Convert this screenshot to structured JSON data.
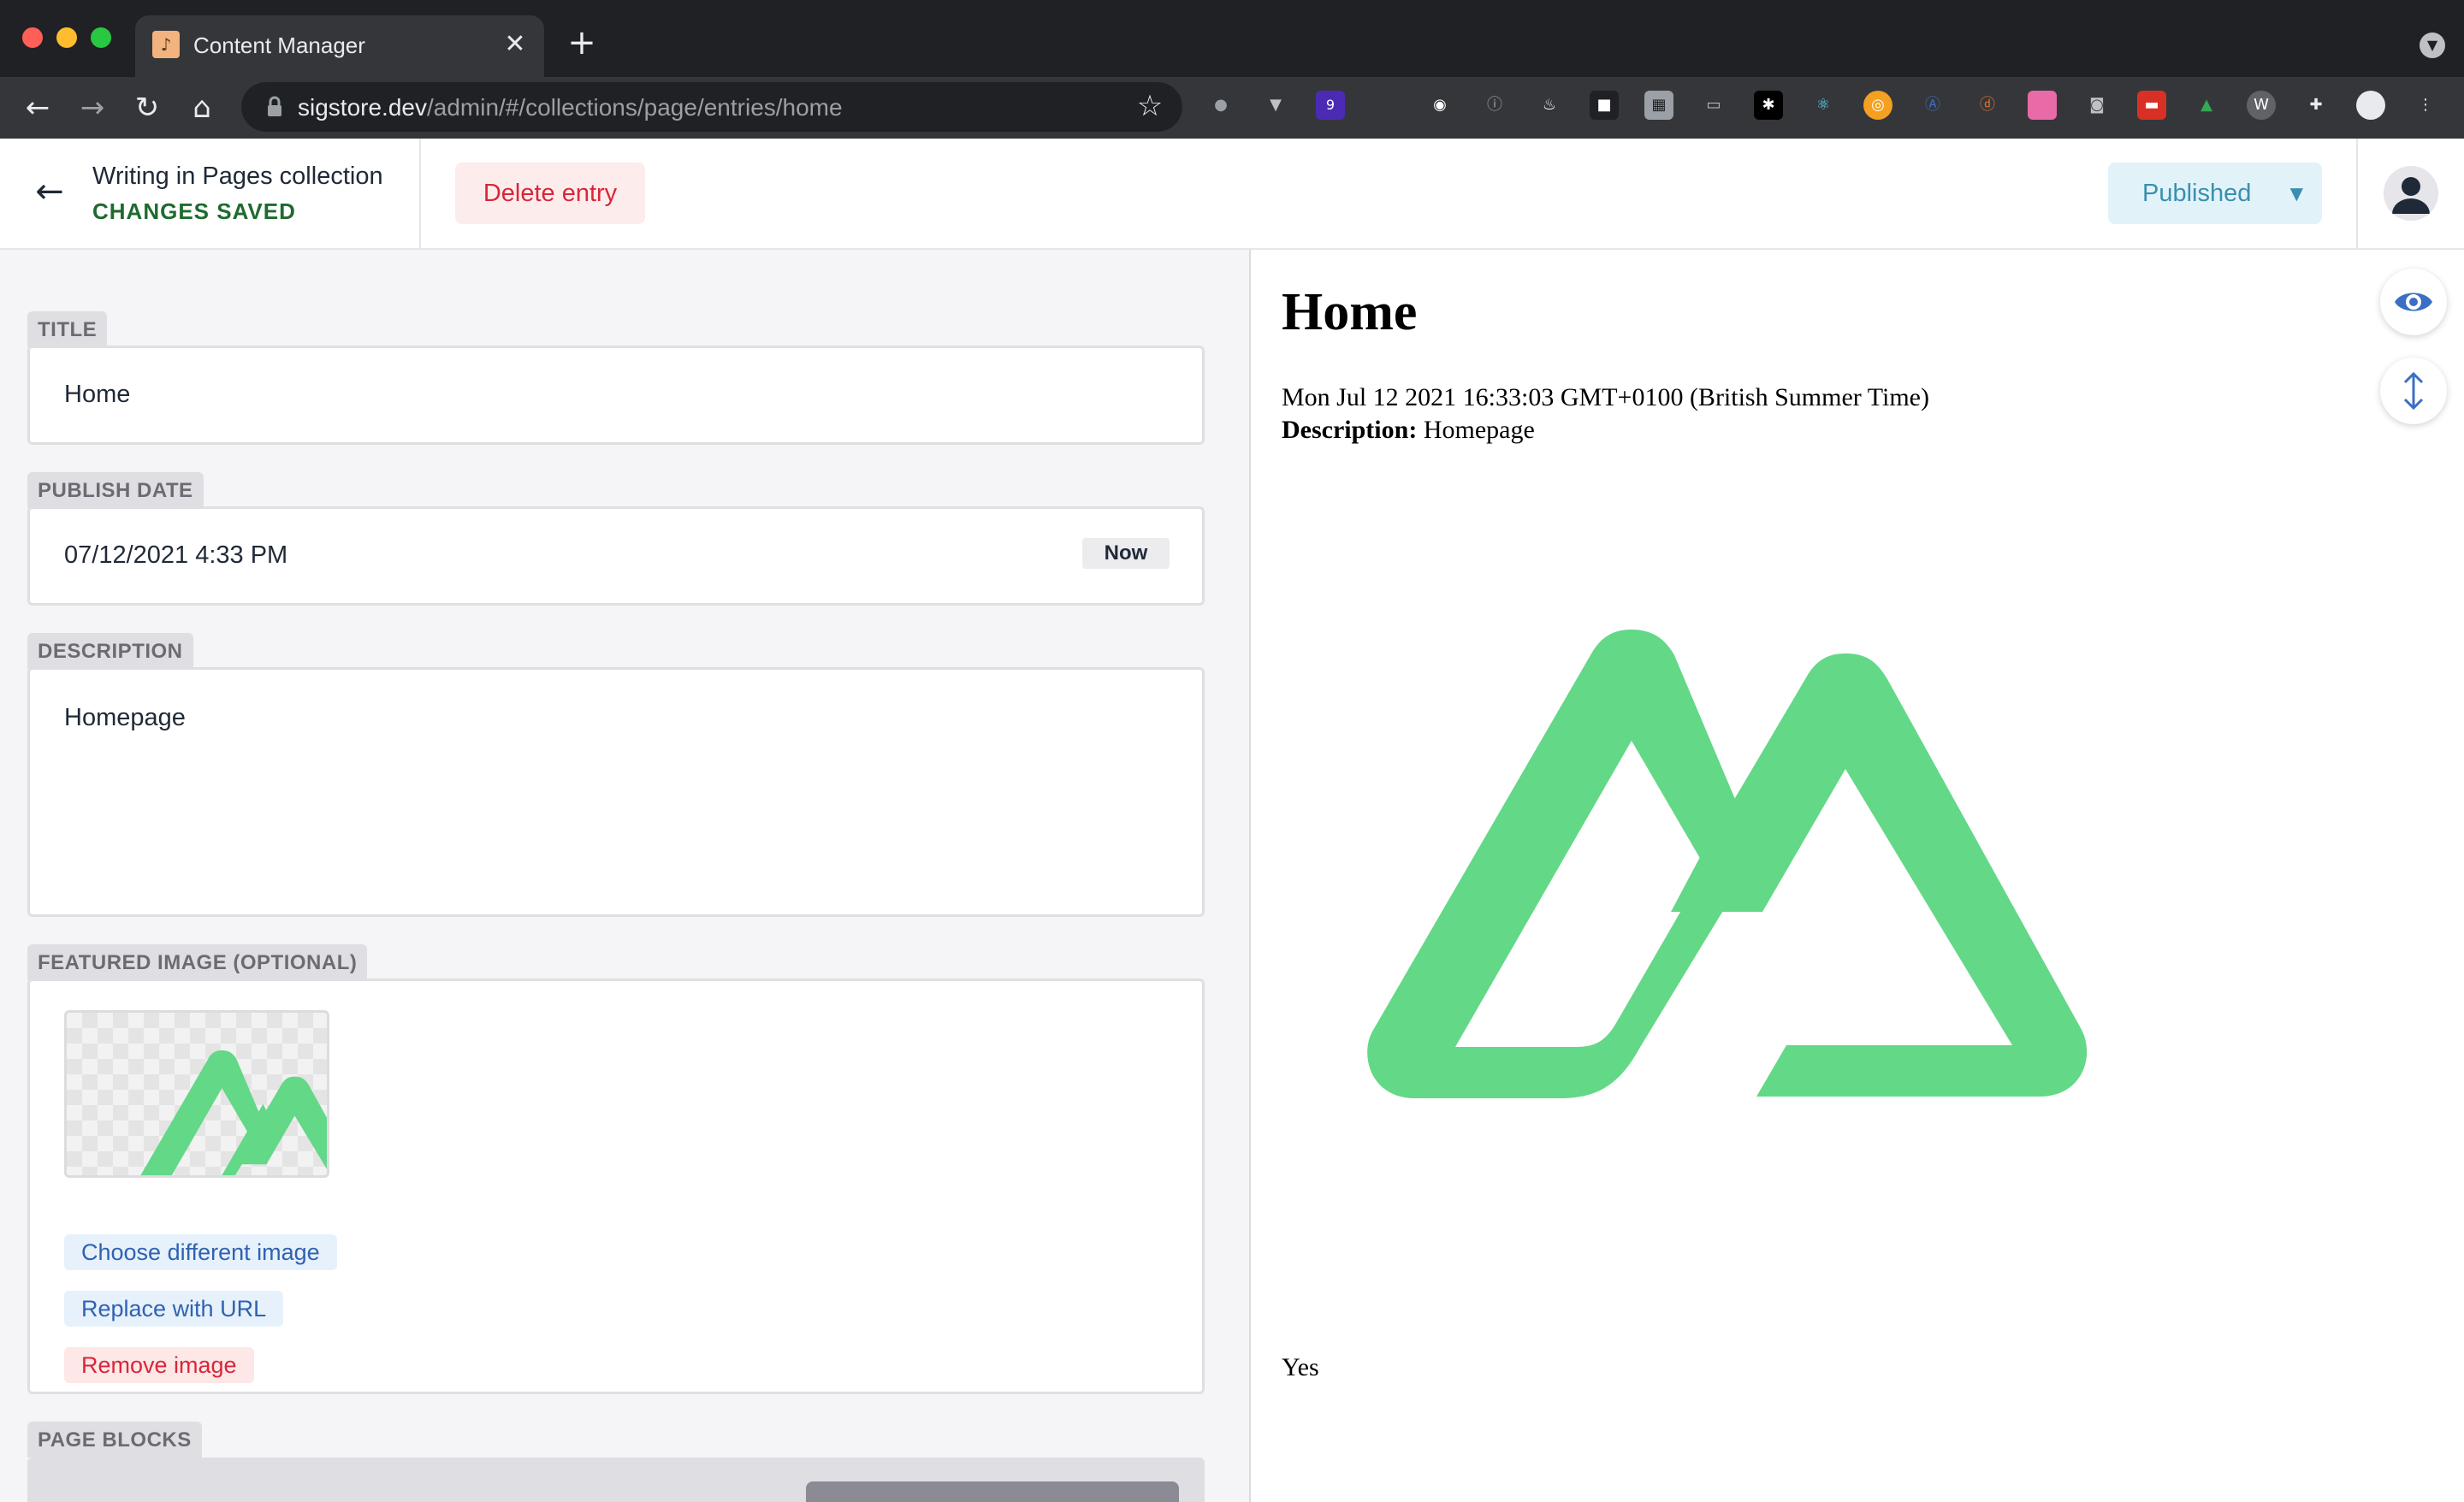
{
  "browser": {
    "tab_title": "Content Manager",
    "tab_close": "✕",
    "new_tab": "+",
    "url_host": "sigstore.dev",
    "url_path": "/admin/#/collections/page/entries/home",
    "extension_badge": "9"
  },
  "header": {
    "collection_title": "Writing in Pages collection",
    "save_status": "CHANGES SAVED",
    "delete_label": "Delete entry",
    "status_label": "Published"
  },
  "fields": {
    "title": {
      "label": "TITLE",
      "value": "Home"
    },
    "publish_date": {
      "label": "PUBLISH DATE",
      "value": "07/12/2021 4:33 PM",
      "now_label": "Now"
    },
    "description": {
      "label": "DESCRIPTION",
      "value": "Homepage"
    },
    "featured_image": {
      "label": "FEATURED IMAGE (OPTIONAL)",
      "choose_label": "Choose different image",
      "replace_label": "Replace with URL",
      "remove_label": "Remove image"
    },
    "page_blocks": {
      "label": "PAGE BLOCKS"
    }
  },
  "preview": {
    "title": "Home",
    "date": "Mon Jul 12 2021 16:33:03 GMT+0100 (British Summer Time)",
    "description_label": "Description:",
    "description_value": "Homepage",
    "footer_text": "Yes"
  },
  "colors": {
    "logo_green": "#63d887",
    "accent_blue": "#3b6fc4",
    "danger_red": "#d9263a",
    "saved_green": "#1e6b2e"
  },
  "icons": [
    "back-arrow-icon",
    "eye-icon",
    "scroll-sync-icon",
    "user-avatar-icon",
    "chevron-down-icon",
    "lock-icon",
    "star-icon"
  ]
}
